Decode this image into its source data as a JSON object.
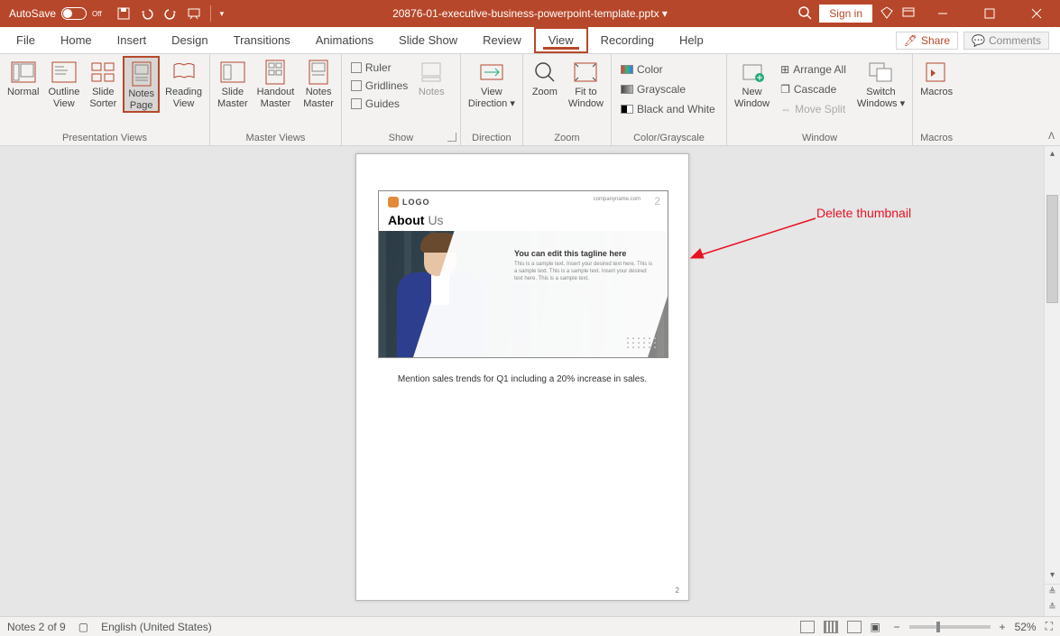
{
  "titlebar": {
    "autosave_label": "AutoSave",
    "autosave_state": "Off",
    "doc_title": "20876-01-executive-business-powerpoint-template.pptx",
    "dirty_marker": "▾",
    "signin": "Sign in"
  },
  "menu": {
    "file": "File",
    "home": "Home",
    "insert": "Insert",
    "design": "Design",
    "transitions": "Transitions",
    "animations": "Animations",
    "slideshow": "Slide Show",
    "review": "Review",
    "view": "View",
    "recording": "Recording",
    "help": "Help",
    "share": "Share",
    "comments": "Comments"
  },
  "ribbon": {
    "presentation_views": {
      "label": "Presentation Views",
      "normal": "Normal",
      "outline": "Outline\nView",
      "sorter": "Slide\nSorter",
      "notespage": "Notes\nPage",
      "reading": "Reading\nView"
    },
    "master_views": {
      "label": "Master Views",
      "slide": "Slide\nMaster",
      "handout": "Handout\nMaster",
      "notes": "Notes\nMaster"
    },
    "show": {
      "label": "Show",
      "ruler": "Ruler",
      "gridlines": "Gridlines",
      "guides": "Guides",
      "notes": "Notes"
    },
    "direction": {
      "label": "Direction",
      "btn": "View\nDirection"
    },
    "zoom": {
      "label": "Zoom",
      "zoom": "Zoom",
      "fit": "Fit to\nWindow"
    },
    "colorgray": {
      "label": "Color/Grayscale",
      "color": "Color",
      "grayscale": "Grayscale",
      "bw": "Black and White"
    },
    "window": {
      "label": "Window",
      "new": "New\nWindow",
      "arrange": "Arrange All",
      "cascade": "Cascade",
      "movesplit": "Move Split",
      "switch": "Switch\nWindows"
    },
    "macros": {
      "label": "Macros",
      "btn": "Macros"
    }
  },
  "annotation": {
    "text": "Delete thumbnail"
  },
  "slide": {
    "logo_text": "LOGO",
    "url": "companyname.com",
    "number": "2",
    "title_b": "About",
    "title_r": "Us",
    "tagline": "You can edit this tagline here",
    "body": "This is a sample text. Insert your desired text here. This is a sample text. This is a sample text. Insert your desired text here. This is a sample text."
  },
  "notes": {
    "line1": "Mention sales trends for Q1 including a 20% increase in sales."
  },
  "page_number": "2",
  "status": {
    "notes": "Notes 2 of 9",
    "lang": "English (United States)",
    "zoom": "52%"
  }
}
